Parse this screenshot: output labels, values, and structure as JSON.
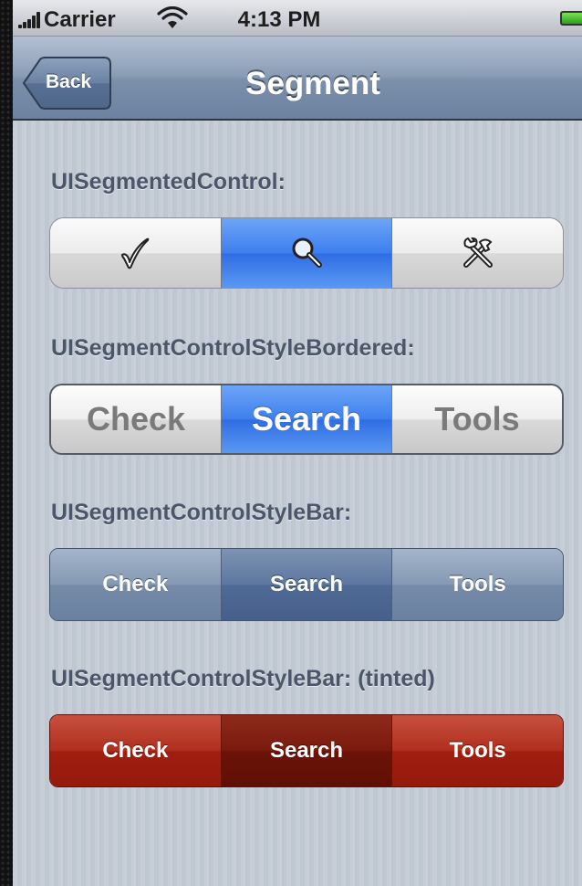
{
  "status_bar": {
    "carrier": "Carrier",
    "time": "4:13 PM",
    "icons": [
      "signal-icon",
      "wifi-icon",
      "battery-icon"
    ]
  },
  "nav_bar": {
    "back_label": "Back",
    "title": "Segment"
  },
  "sections": {
    "plain": {
      "label": "UISegmentedControl:",
      "segments": [
        "checkmark-icon",
        "magnifier-icon",
        "tools-icon"
      ],
      "selected_index": 1
    },
    "bordered": {
      "label": "UISegmentControlStyleBordered:",
      "segments": [
        "Check",
        "Search",
        "Tools"
      ],
      "selected_index": 1
    },
    "bar": {
      "label": "UISegmentControlStyleBar:",
      "segments": [
        "Check",
        "Search",
        "Tools"
      ],
      "selected_index": 1
    },
    "tinted": {
      "label": "UISegmentControlStyleBar: (tinted)",
      "segments": [
        "Check",
        "Search",
        "Tools"
      ],
      "selected_index": 1
    }
  },
  "colors": {
    "selected_blue": "#3d7fee",
    "bar_blue": "#758ba8",
    "tint_red": "#a01e10",
    "label_text": "#4c566a"
  }
}
